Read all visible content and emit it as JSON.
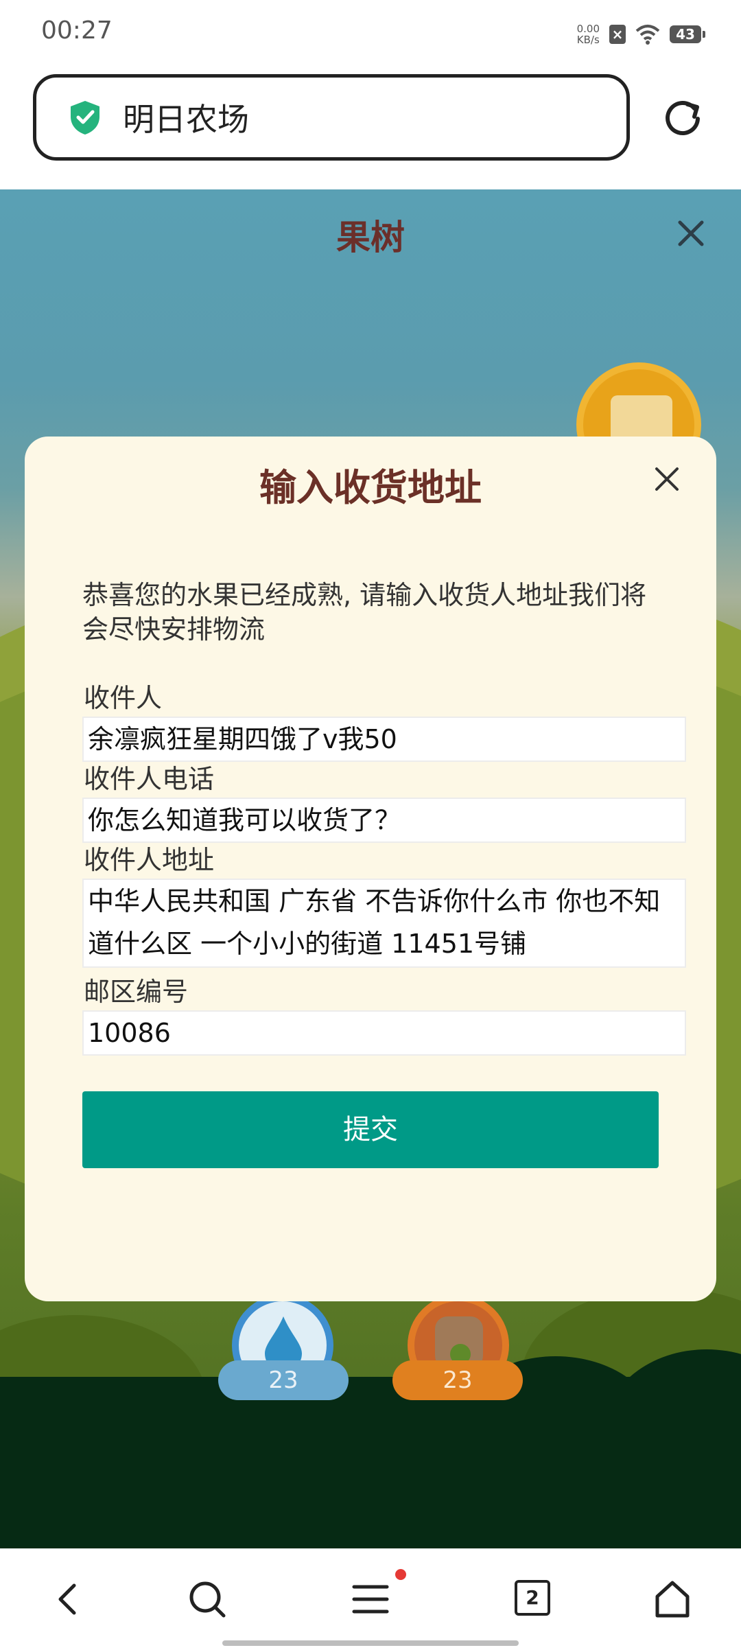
{
  "status_bar": {
    "time": "00:27",
    "net_speed_value": "0.00",
    "net_speed_unit": "KB/s",
    "battery": "43"
  },
  "browser": {
    "url_title": "明日农场",
    "tabs_count": "2"
  },
  "game": {
    "title": "果树",
    "water_count": "23",
    "bag_count": "23"
  },
  "dialog": {
    "title": "输入收货地址",
    "message": "恭喜您的水果已经成熟, 请输入收货人地址我们将会尽快安排物流",
    "fields": [
      {
        "label": "收件人",
        "value": "余凛疯狂星期四饿了v我50"
      },
      {
        "label": "收件人电话",
        "value": "你怎么知道我可以收货了？"
      },
      {
        "label": "收件人地址",
        "value": "中华人民共和国 广东省 不告诉你什么市 你也不知道什么区 一个小小的街道 11451号铺"
      },
      {
        "label": "邮区编号",
        "value": "10086"
      }
    ],
    "submit_label": "提交"
  },
  "colors": {
    "accent": "#009a87",
    "dialog_bg": "#fdf8e6",
    "title_brown": "#6b3027"
  }
}
